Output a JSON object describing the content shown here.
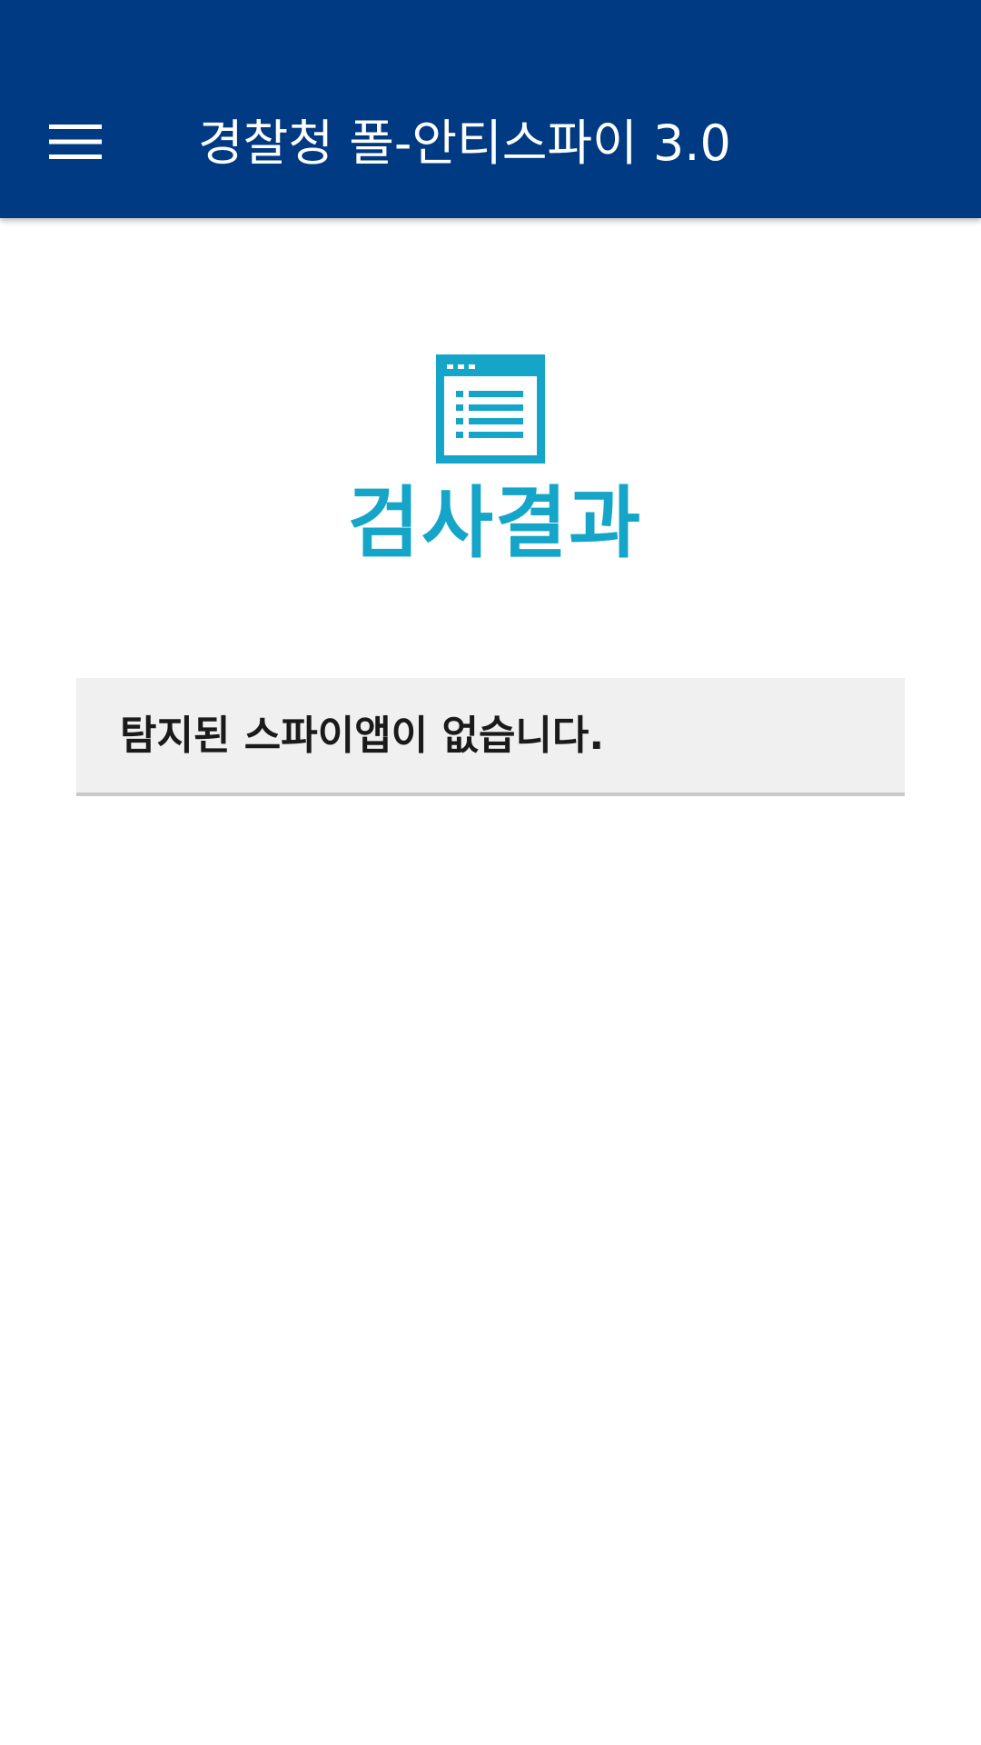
{
  "app": {
    "title": "경찰청 폴-안티스파이 3.0"
  },
  "toolbar": {
    "menu_icon": "hamburger-menu-icon",
    "background_color": "#003a82",
    "text_color": "#ffffff"
  },
  "result_logo": {
    "icon": "document-list-icon",
    "label": "검사결과",
    "color": "#14a5c8"
  },
  "result": {
    "message": "탐지된 스파이앱이 없습니다."
  }
}
